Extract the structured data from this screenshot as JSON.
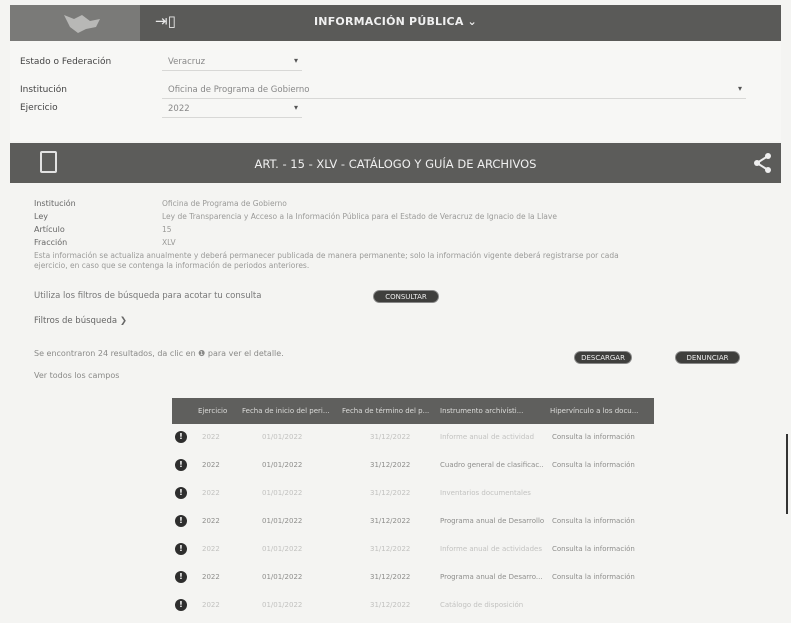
{
  "header": {
    "title": "INFORMACIÓN PÚBLICA ⌄",
    "login_icon": "login-icon"
  },
  "filters": {
    "estado_label": "Estado o Federación",
    "estado_value": "Veracruz",
    "institucion_label": "Institución",
    "institucion_value": "Oficina de Programa de Gobierno",
    "ejercicio_label": "Ejercicio",
    "ejercicio_value": "2022"
  },
  "section": {
    "title": "ART. - 15 - XLV - CATÁLOGO Y GUÍA DE ARCHIVOS",
    "icon": "document-icon",
    "share_icon": "share-icon"
  },
  "info": {
    "institucion_label": "Institución",
    "institucion_value": "Oficina de Programa de Gobierno",
    "ley_label": "Ley",
    "ley_value": "Ley de Transparencia y Acceso a la Información Pública para el Estado de Veracruz de Ignacio de la Llave",
    "articulo_label": "Artículo",
    "articulo_value": "15",
    "fraccion_label": "Fracción",
    "fraccion_value": "XLV",
    "note": "Esta información se actualiza anualmente y deberá permanecer publicada de manera permanente; solo la información vigente deberá registrarse por cada ejercicio, en caso que se contenga la información de periodos anteriores."
  },
  "search": {
    "hint": "Utiliza los filtros de búsqueda para acotar tu consulta",
    "consultar_button": "CONSULTAR",
    "filters_toggle": "Filtros de búsqueda ❯"
  },
  "results": {
    "text": "Se encontraron 24 resultados, da clic en ❶ para ver el detalle.",
    "subtext": "Ver todos los campos",
    "descargar_button": "DESCARGAR",
    "denunciar_button": "DENUNCIAR"
  },
  "table": {
    "headers": [
      "Ejercicio",
      "Fecha de inicio del peri...",
      "Fecha de término del p...",
      "Instrumento archivísti...",
      "Hipervínculo a los docu..."
    ],
    "rows": [
      {
        "ejercicio": "2022",
        "inicio": "01/01/2022",
        "termino": "31/12/2022",
        "instrumento": "Informe anual de actividad",
        "hipervinculo": "Consulta la información",
        "faded": true
      },
      {
        "ejercicio": "2022",
        "inicio": "01/01/2022",
        "termino": "31/12/2022",
        "instrumento": "Cuadro general de clasificac...",
        "hipervinculo": "Consulta la información",
        "faded": false
      },
      {
        "ejercicio": "2022",
        "inicio": "01/01/2022",
        "termino": "31/12/2022",
        "instrumento": "Inventarios documentales",
        "hipervinculo": "",
        "faded": true
      },
      {
        "ejercicio": "2022",
        "inicio": "01/01/2022",
        "termino": "31/12/2022",
        "instrumento": "Programa anual de Desarrollo",
        "hipervinculo": "Consulta la información",
        "faded": false
      },
      {
        "ejercicio": "2022",
        "inicio": "01/01/2022",
        "termino": "31/12/2022",
        "instrumento": "Informe anual de actividades",
        "hipervinculo": "Consulta la información",
        "faded": true
      },
      {
        "ejercicio": "2022",
        "inicio": "01/01/2022",
        "termino": "31/12/2022",
        "instrumento": "Programa anual de Desarro...",
        "hipervinculo": "Consulta la información",
        "faded": false
      },
      {
        "ejercicio": "2022",
        "inicio": "01/01/2022",
        "termino": "31/12/2022",
        "instrumento": "Catálogo de disposición",
        "hipervinculo": "",
        "faded": true
      }
    ]
  }
}
